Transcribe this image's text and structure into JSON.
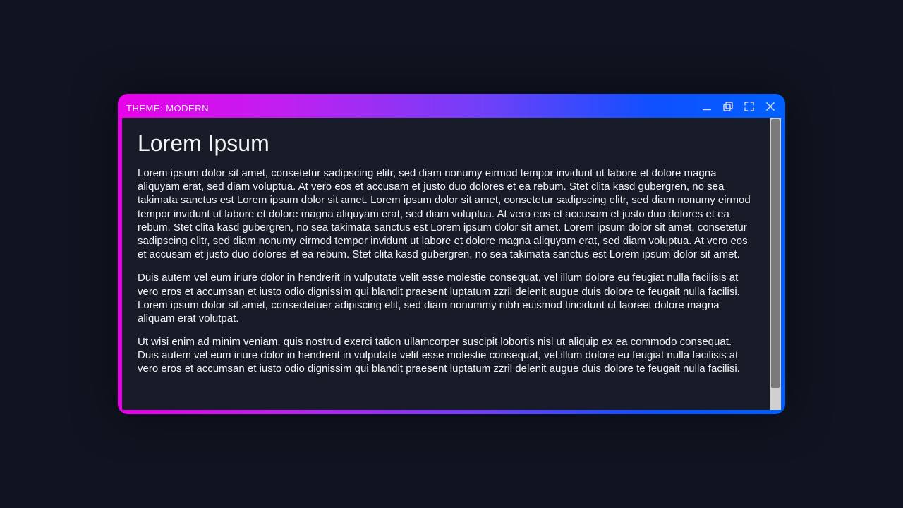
{
  "titlebar": {
    "label": "THEME: MODERN"
  },
  "content": {
    "heading": "Lorem Ipsum",
    "paragraphs": [
      "Lorem ipsum dolor sit amet, consetetur sadipscing elitr, sed diam nonumy eirmod tempor invidunt ut labore et dolore magna aliquyam erat, sed diam voluptua. At vero eos et accusam et justo duo dolores et ea rebum. Stet clita kasd gubergren, no sea takimata sanctus est Lorem ipsum dolor sit amet. Lorem ipsum dolor sit amet, consetetur sadipscing elitr, sed diam nonumy eirmod tempor invidunt ut labore et dolore magna aliquyam erat, sed diam voluptua. At vero eos et accusam et justo duo dolores et ea rebum. Stet clita kasd gubergren, no sea takimata sanctus est Lorem ipsum dolor sit amet. Lorem ipsum dolor sit amet, consetetur sadipscing elitr, sed diam nonumy eirmod tempor invidunt ut labore et dolore magna aliquyam erat, sed diam voluptua. At vero eos et accusam et justo duo dolores et ea rebum. Stet clita kasd gubergren, no sea takimata sanctus est Lorem ipsum dolor sit amet.",
      "Duis autem vel eum iriure dolor in hendrerit in vulputate velit esse molestie consequat, vel illum dolore eu feugiat nulla facilisis at vero eros et accumsan et iusto odio dignissim qui blandit praesent luptatum zzril delenit augue duis dolore te feugait nulla facilisi. Lorem ipsum dolor sit amet, consectetuer adipiscing elit, sed diam nonummy nibh euismod tincidunt ut laoreet dolore magna aliquam erat volutpat.",
      "Ut wisi enim ad minim veniam, quis nostrud exerci tation ullamcorper suscipit lobortis nisl ut aliquip ex ea commodo consequat. Duis autem vel eum iriure dolor in hendrerit in vulputate velit esse molestie consequat, vel illum dolore eu feugiat nulla facilisis at vero eros et accumsan et iusto odio dignissim qui blandit praesent luptatum zzril delenit augue duis dolore te feugait nulla facilisi."
    ]
  }
}
